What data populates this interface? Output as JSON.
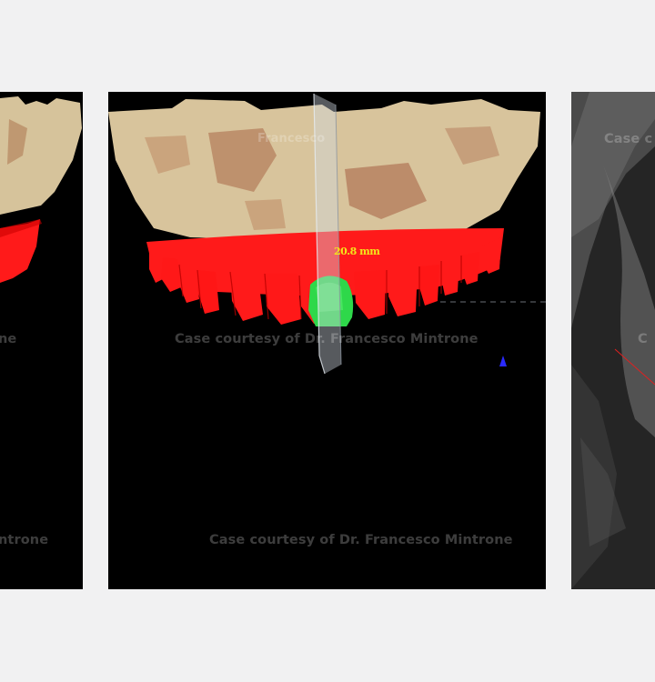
{
  "gallery": {
    "slides": [
      {
        "id": "left",
        "watermarks": [
          "ne",
          "ntrone"
        ]
      },
      {
        "id": "center",
        "watermarks": [
          "Francesco",
          "Case courtesy of Dr. Francesco Mintrone",
          "Case courtesy of Dr. Francesco Mintrone"
        ],
        "measurement": "20.8 mm",
        "colors": {
          "bone": "#d8c49c",
          "gums_teeth": "#ff1a1a",
          "implant": "#2ed84a"
        }
      },
      {
        "id": "right",
        "watermarks": [
          "Case c",
          "C"
        ]
      }
    ]
  }
}
